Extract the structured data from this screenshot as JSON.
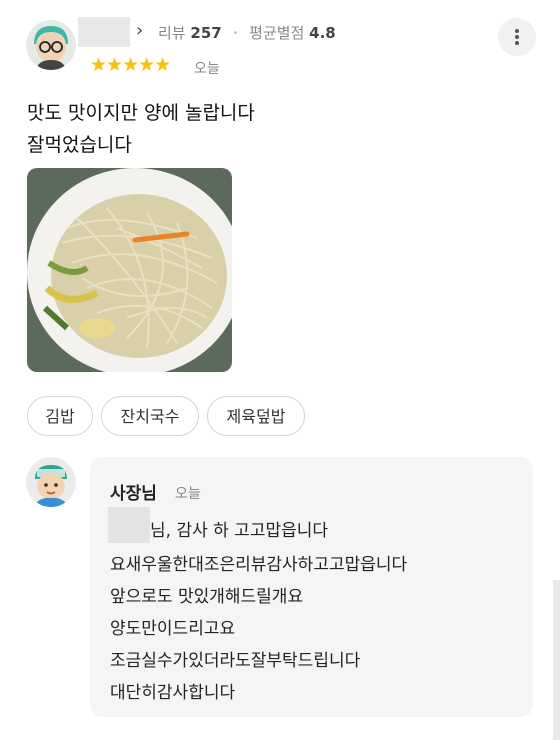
{
  "reviewer": {
    "chevron": "›",
    "review_label": "리뷰",
    "review_count": "257",
    "separator": "•",
    "avg_label": "평균별점",
    "avg_rating": "4.8",
    "rating": 5,
    "stars": "★★★★★",
    "date": "오늘"
  },
  "review": {
    "lines": [
      "맛도 맛이지만 양에 놀랍니다",
      "잘먹었습니다"
    ]
  },
  "menu_tags": [
    "김밥",
    "잔치국수",
    "제육덮밥"
  ],
  "owner_reply": {
    "name": "사장님",
    "date": "오늘",
    "lines": [
      "님, 감사 하 고고맙읍니다",
      "요새우울한대조은리뷰감사하고고맙읍니다",
      "앞으로도 맛있개해드릴개요",
      "양도만이드리고요",
      "조금실수가있더라도잘부탁드립니다",
      "대단히감사합니다"
    ]
  },
  "colors": {
    "star": "#f7c10a",
    "muted": "#888888",
    "bubble": "#f5f5f5"
  },
  "icons": {
    "more": "more-vertical-icon",
    "chevron": "chevron-right-icon"
  }
}
